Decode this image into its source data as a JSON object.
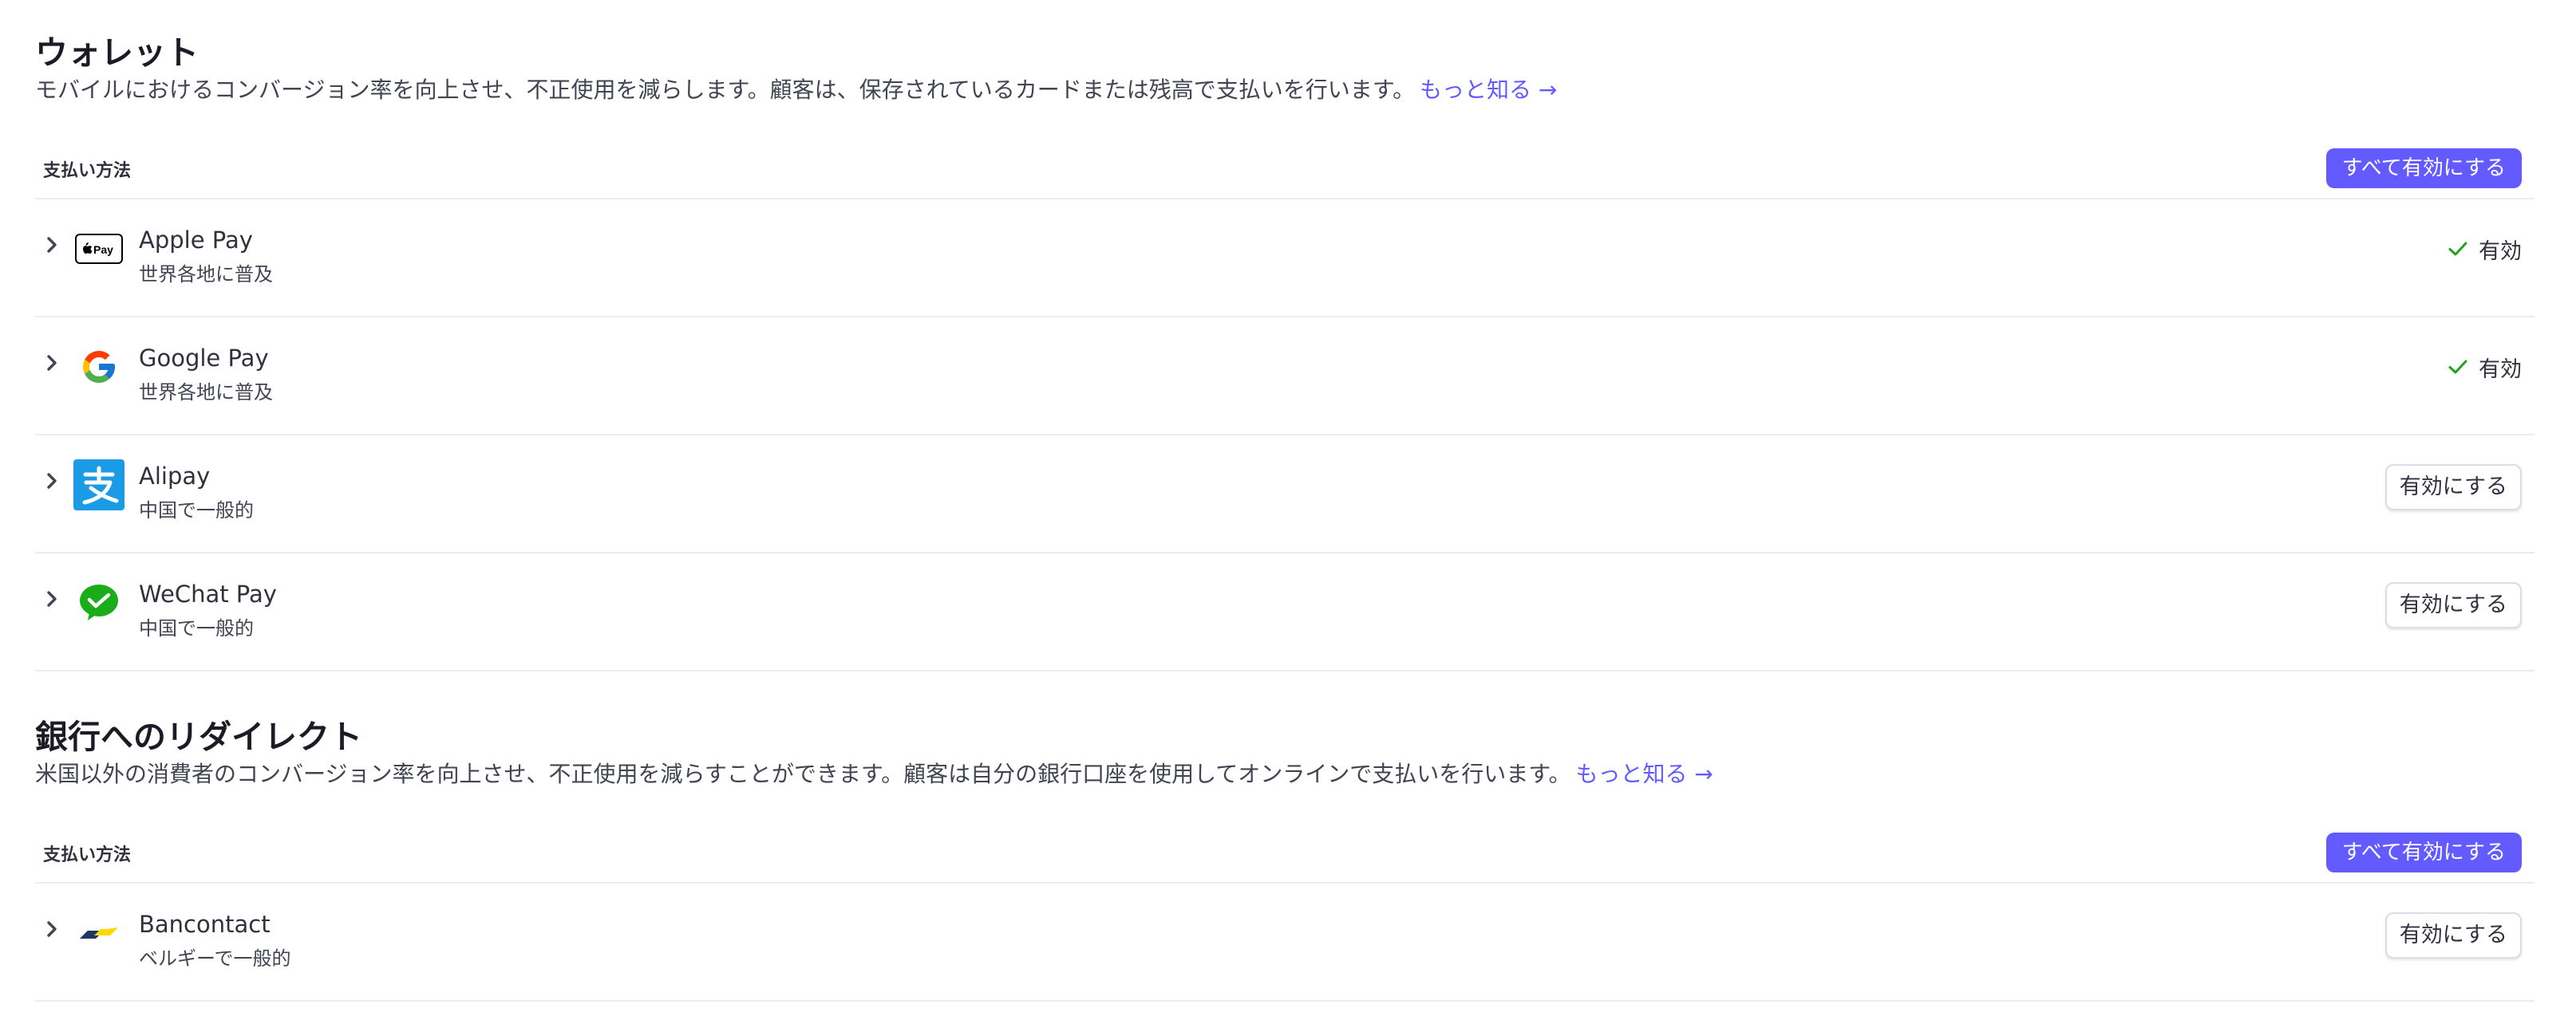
{
  "wallets": {
    "title": "ウォレット",
    "description": "モバイルにおけるコンバージョン率を向上させ、不正使用を減らします。顧客は、保存されているカードまたは残高で支払いを行います。",
    "learn_more": "もっと知る →",
    "header_label": "支払い方法",
    "enable_all_label": "すべて有効にする",
    "methods": [
      {
        "name": "Apple Pay",
        "subtitle": "世界各地に普及",
        "icon": "apple-pay-icon",
        "enabled": true,
        "status_label": "有効"
      },
      {
        "name": "Google Pay",
        "subtitle": "世界各地に普及",
        "icon": "google-icon",
        "enabled": true,
        "status_label": "有効"
      },
      {
        "name": "Alipay",
        "subtitle": "中国で一般的",
        "icon": "alipay-icon",
        "enabled": false,
        "action_label": "有効にする"
      },
      {
        "name": "WeChat Pay",
        "subtitle": "中国で一般的",
        "icon": "wechat-pay-icon",
        "enabled": false,
        "action_label": "有効にする"
      }
    ]
  },
  "bank_redirects": {
    "title": "銀行へのリダイレクト",
    "description": "米国以外の消費者のコンバージョン率を向上させ、不正使用を減らすことができます。顧客は自分の銀行口座を使用してオンラインで支払いを行います。",
    "learn_more": "もっと知る →",
    "header_label": "支払い方法",
    "enable_all_label": "すべて有効にする",
    "methods": [
      {
        "name": "Bancontact",
        "subtitle": "ベルギーで一般的",
        "icon": "bancontact-icon",
        "enabled": false,
        "action_label": "有効にする"
      }
    ]
  },
  "colors": {
    "accent": "#635bff",
    "success": "#1ea51e",
    "alipay_blue": "#1b9be6",
    "wechat_green": "#1aad19"
  }
}
